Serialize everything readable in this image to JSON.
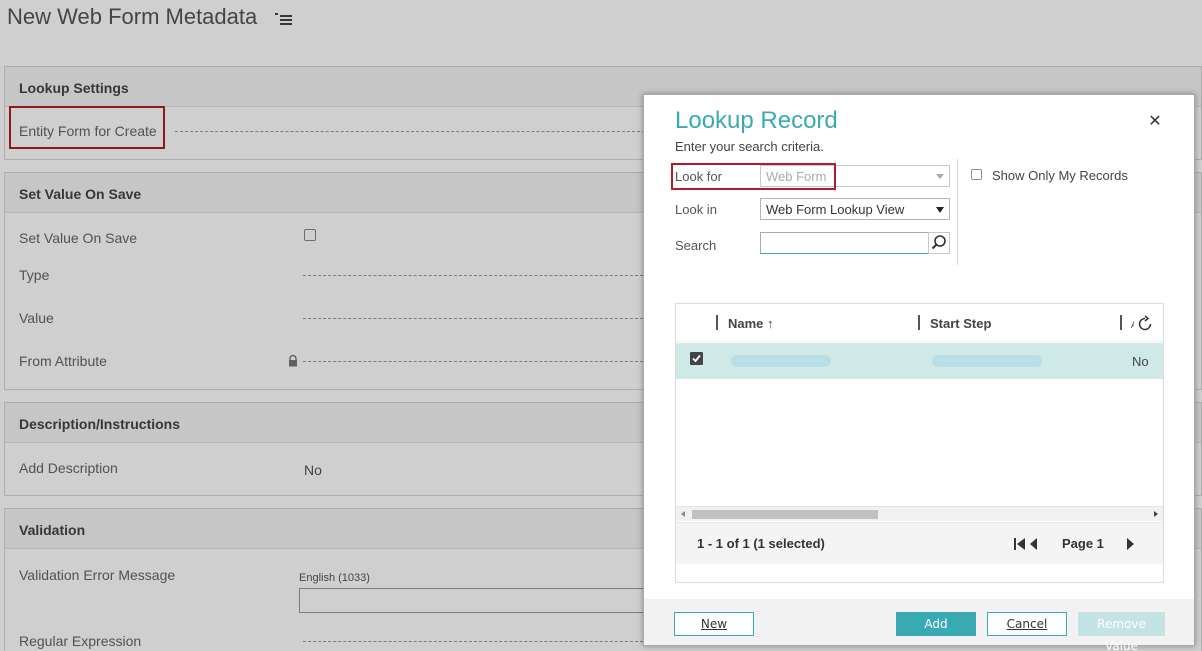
{
  "page": {
    "title": "New Web Form Metadata",
    "sections": {
      "lookup": {
        "header": "Lookup Settings",
        "entity_form_label": "Entity Form for Create"
      },
      "set_value": {
        "header": "Set Value On Save",
        "set_value_label": "Set Value On Save",
        "type_label": "Type",
        "value_label": "Value",
        "from_attribute_label": "From Attribute"
      },
      "description": {
        "header": "Description/Instructions",
        "add_description_label": "Add Description",
        "add_description_value": "No"
      },
      "validation": {
        "header": "Validation",
        "error_message_label": "Validation Error Message",
        "language_label": "English (1033)",
        "regex_label": "Regular Expression"
      }
    }
  },
  "dialog": {
    "title": "Lookup Record",
    "subtitle": "Enter your search criteria.",
    "close_glyph": "✕",
    "look_for_label": "Look for",
    "look_for_value": "Web Form",
    "look_in_label": "Look in",
    "look_in_value": "Web Form Lookup View",
    "search_label": "Search",
    "search_value": "",
    "show_only_mine_label": "Show Only My Records",
    "grid": {
      "columns": [
        "Name ↑",
        "Start Step",
        "A"
      ],
      "rows": [
        {
          "selected": true,
          "col3": "No"
        }
      ],
      "status": "1 - 1 of 1 (1 selected)",
      "page_label": "Page 1"
    },
    "buttons": {
      "new": "New",
      "add": "Add",
      "cancel": "Cancel",
      "remove": "Remove Value"
    }
  },
  "colors": {
    "accent": "#3aaab2",
    "highlight_box": "#b31d2b",
    "selected_row": "#cfe9e7"
  }
}
